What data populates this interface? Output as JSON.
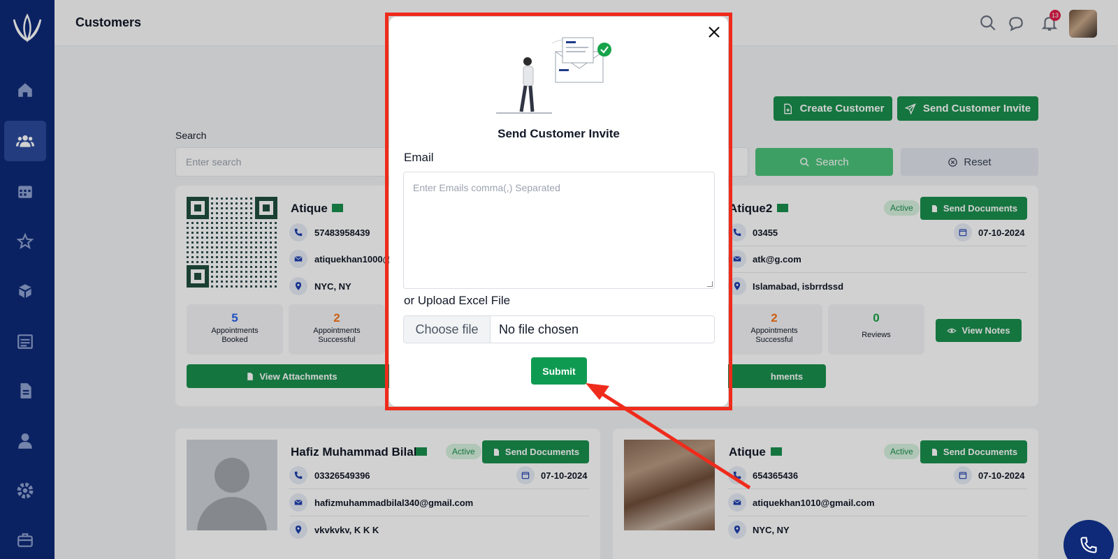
{
  "header": {
    "title": "Customers",
    "notification_count": "13"
  },
  "actions": {
    "create_customer": "Create Customer",
    "send_invite": "Send Customer Invite"
  },
  "search": {
    "label": "Search",
    "placeholder": "Enter search",
    "search_button": "Search",
    "reset_button": "Reset"
  },
  "cards": [
    {
      "name": "Atique",
      "phone": "57483958439",
      "email": "atiquekhan1000@",
      "location": "NYC, NY",
      "stats": [
        {
          "value": "5",
          "label": "Appointments Booked"
        },
        {
          "value": "2",
          "label": "Appointments Successful"
        }
      ],
      "attachments_button": "View Attachments"
    },
    {
      "name": "Atique2",
      "status": "Active",
      "send_documents": "Send Documents",
      "phone": "03455",
      "date": "07-10-2024",
      "email": "atk@g.com",
      "location": "Islamabad, isbrrdssd",
      "stats": [
        {
          "value": "2",
          "label": "Appointments Successful"
        },
        {
          "value": "0",
          "label": "Reviews"
        }
      ],
      "notes_button": "View Notes",
      "attachments_button": "hments"
    },
    {
      "name": "Hafiz Muhammad Bilal",
      "status": "Active",
      "send_documents": "Send Documents",
      "phone": "03326549396",
      "date": "07-10-2024",
      "email": "hafizmuhammadbilal340@gmail.com",
      "location": "vkvkvkv, K K K"
    },
    {
      "name": "Atique",
      "status": "Active",
      "send_documents": "Send Documents",
      "phone": "654365436",
      "date": "07-10-2024",
      "email": "atiquekhan1010@gmail.com",
      "location": "NYC, NY"
    }
  ],
  "modal": {
    "title": "Send Customer Invite",
    "email_label": "Email",
    "email_placeholder": "Enter Emails comma(,) Separated",
    "upload_label": "or Upload Excel File",
    "choose_file": "Choose file",
    "no_file": "No file chosen",
    "submit": "Submit"
  },
  "colors": {
    "sidebar": "#0e2a78",
    "primary_green": "#1a8f4e",
    "highlight_red": "#ef2b1c"
  }
}
